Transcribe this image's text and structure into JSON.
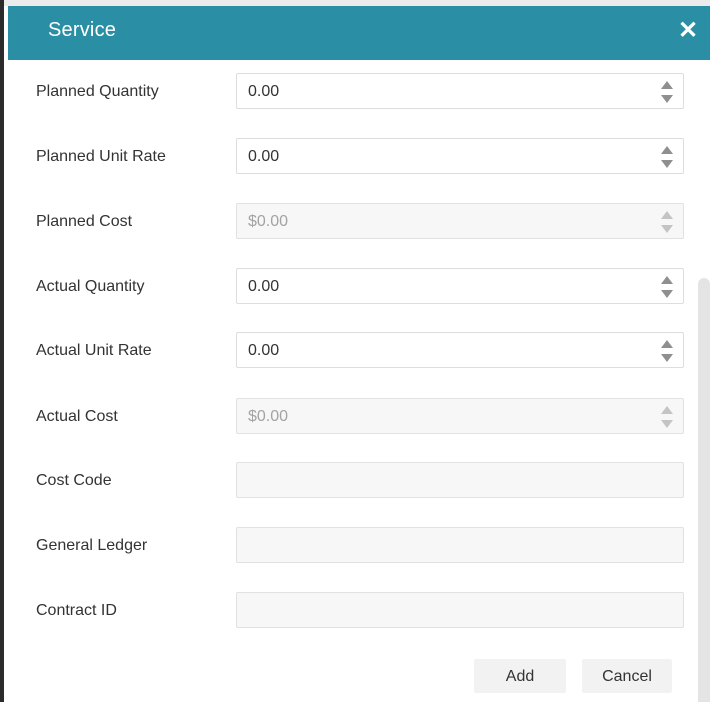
{
  "dialog": {
    "title": "Service",
    "close_glyph": "✕",
    "close_icon": "close-icon"
  },
  "fields": [
    {
      "key": "planned-quantity",
      "label": "Planned Quantity",
      "value": "0.00",
      "type": "number",
      "disabled": false
    },
    {
      "key": "planned-unit-rate",
      "label": "Planned Unit Rate",
      "value": "0.00",
      "type": "number",
      "disabled": false
    },
    {
      "key": "planned-cost",
      "label": "Planned Cost",
      "value": "$0.00",
      "type": "number",
      "disabled": true
    },
    {
      "key": "actual-quantity",
      "label": "Actual Quantity",
      "value": "0.00",
      "type": "number",
      "disabled": false
    },
    {
      "key": "actual-unit-rate",
      "label": "Actual Unit Rate",
      "value": "0.00",
      "type": "number",
      "disabled": false
    },
    {
      "key": "actual-cost",
      "label": "Actual Cost",
      "value": "$0.00",
      "type": "number",
      "disabled": true
    },
    {
      "key": "cost-code",
      "label": "Cost Code",
      "value": "",
      "type": "text",
      "disabled": true
    },
    {
      "key": "general-ledger",
      "label": "General Ledger",
      "value": "",
      "type": "text",
      "disabled": true
    },
    {
      "key": "contract-id",
      "label": "Contract ID",
      "value": "",
      "type": "text",
      "disabled": true
    }
  ],
  "buttons": {
    "add": "Add",
    "cancel": "Cancel"
  },
  "colors": {
    "header": "#2a8fa4",
    "header_text": "#ffffff",
    "label_text": "#333333",
    "disabled_bg": "#f7f7f7",
    "button_bg": "#f2f2f2"
  }
}
